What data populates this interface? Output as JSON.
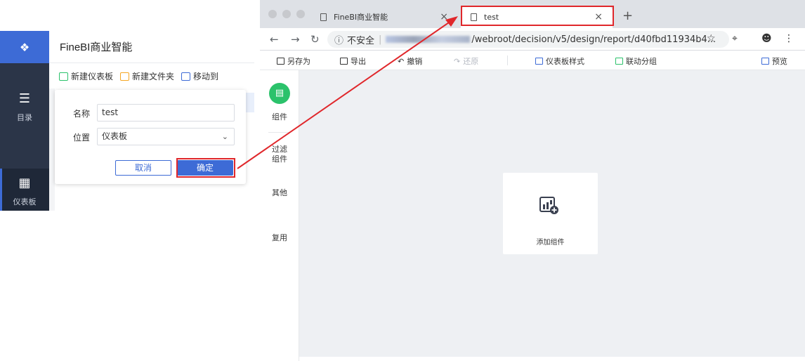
{
  "finebi": {
    "app_title": "FineBI商业智能",
    "logo_icon": "finebi-logo-icon",
    "nav": [
      {
        "label": "目录",
        "icon": "list-icon"
      },
      {
        "label": "仪表板",
        "icon": "dashboard-grid-icon"
      }
    ],
    "toolbar": {
      "new_dashboard": "新建仪表板",
      "new_folder": "新建文件夹",
      "move_to": "移动到"
    },
    "dialog": {
      "name_label": "名称",
      "name_value": "test",
      "location_label": "位置",
      "location_value": "仪表板",
      "cancel_label": "取消",
      "ok_label": "确定"
    }
  },
  "browser": {
    "tabs": [
      {
        "title": "FineBI商业智能"
      },
      {
        "title": "test"
      }
    ],
    "address": {
      "insecure_label": "不安全",
      "url_visible": "/webroot/decision/v5/design/report/d40fbd11934b4..."
    },
    "design_toolbar": {
      "save_as": "另存为",
      "export": "导出",
      "undo": "撤销",
      "redo": "还原",
      "dashboard_style": "仪表板样式",
      "linkage_group": "联动分组",
      "preview": "预览"
    },
    "component_panel": {
      "components": "组件",
      "filter_components": "过滤\n组件",
      "other": "其他",
      "reuse": "复用"
    },
    "canvas": {
      "add_component": "添加组件"
    }
  },
  "colors": {
    "accent": "#3d6bd6",
    "sidebar": "#2b3548",
    "highlight_red": "#e0272b",
    "component_green": "#2bc26b"
  }
}
